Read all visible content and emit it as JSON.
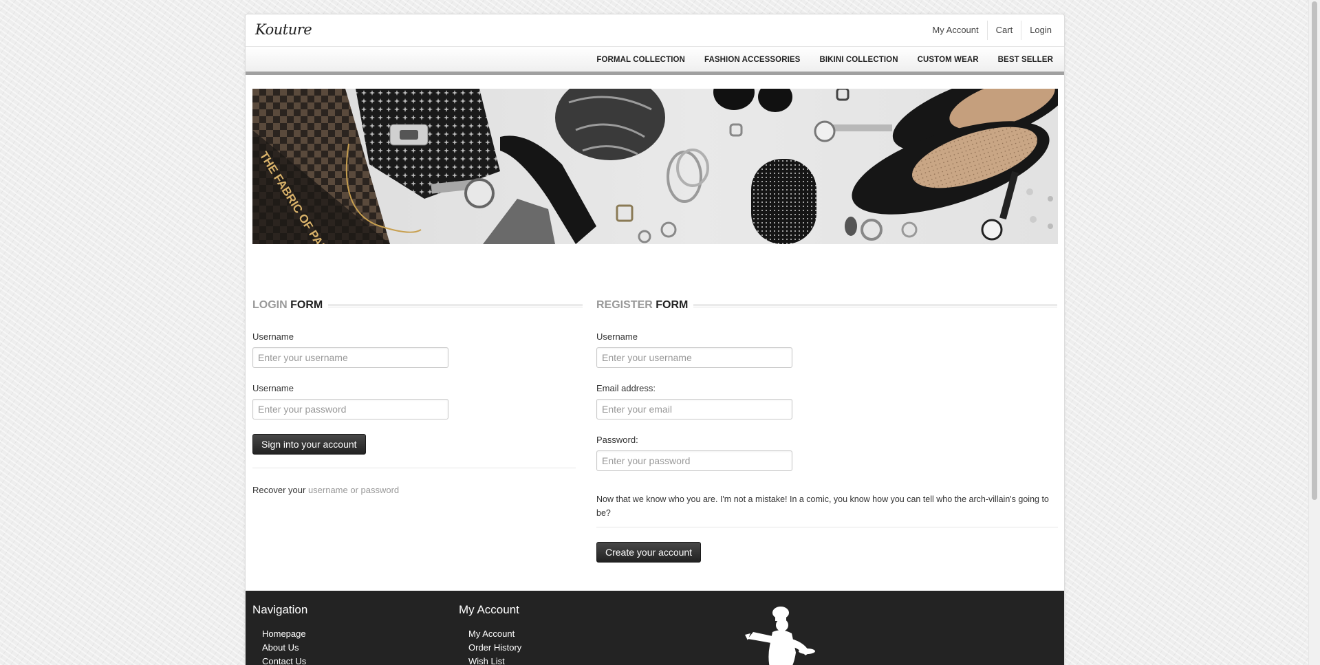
{
  "header": {
    "logo": "Kouture",
    "links": [
      "My Account",
      "Cart",
      "Login"
    ]
  },
  "nav": [
    "FORMAL COLLECTION",
    "FASHION ACCESSORIES",
    "BIKINI COLLECTION",
    "CUSTOM WEAR",
    "BEST SELLER"
  ],
  "banner": {
    "bag_text": "THE FABRIC OF PAK"
  },
  "login": {
    "title_light": "LOGIN",
    "title_dark": "FORM",
    "username_label": "Username",
    "username_placeholder": "Enter your username",
    "password_label": "Username",
    "password_placeholder": "Enter your password",
    "submit": "Sign into your account",
    "recover_text": "Recover your",
    "recover_link": "username or password"
  },
  "register": {
    "title_light": "REGISTER",
    "title_dark": "FORM",
    "username_label": "Username",
    "username_placeholder": "Enter your username",
    "email_label": "Email address:",
    "email_placeholder": "Enter your email",
    "password_label": "Password:",
    "password_placeholder": "Enter your password",
    "note": "Now that we know who you are. I'm not a mistake! In a comic, you know how you can tell who the arch-villain's going to be?",
    "submit": "Create your account"
  },
  "footer": {
    "nav_title": "Navigation",
    "nav_links": [
      "Homepage",
      "About Us",
      "Contact Us"
    ],
    "account_title": "My Account",
    "account_links": [
      "My Account",
      "Order History",
      "Wish List"
    ]
  }
}
